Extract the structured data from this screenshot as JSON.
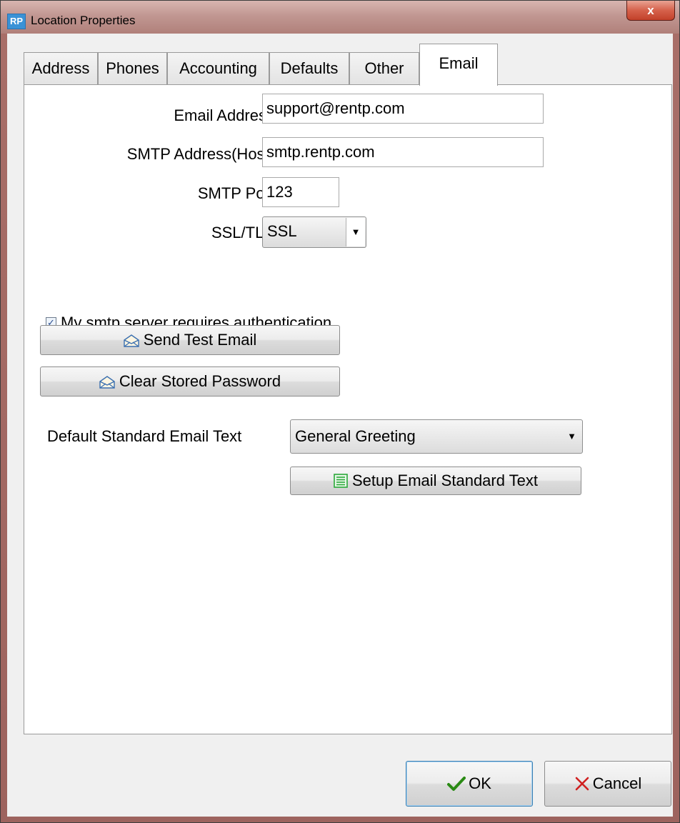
{
  "window": {
    "title": "Location Properties",
    "app_icon": "RP",
    "close_glyph": "x"
  },
  "tabs": [
    {
      "label": "Address",
      "active": false
    },
    {
      "label": "Phones",
      "active": false
    },
    {
      "label": "Accounting",
      "active": false
    },
    {
      "label": "Defaults",
      "active": false
    },
    {
      "label": "Other",
      "active": false
    },
    {
      "label": "Email",
      "active": true
    }
  ],
  "email_tab": {
    "email_address_label": "Email Address",
    "email_address_value": "support@rentp.com",
    "smtp_host_label": "SMTP Address(Host)",
    "smtp_host_value": "smtp.rentp.com",
    "smtp_port_label": "SMTP Port",
    "smtp_port_value": "123",
    "ssl_label": "SSL/TLS",
    "ssl_value": "SSL",
    "auth_checkbox_label": "My smtp server requires authentication",
    "auth_checked": true,
    "send_test_label": "Send Test Email",
    "clear_password_label": "Clear Stored Password",
    "default_text_label": "Default Standard Email Text",
    "default_text_value": "General Greeting",
    "setup_text_label": "Setup Email Standard Text"
  },
  "footer": {
    "ok_label": "OK",
    "cancel_label": "Cancel"
  },
  "icons": {
    "ok": "checkmark-icon",
    "cancel": "x-icon",
    "email": "envelope-icon",
    "setup": "list-icon"
  },
  "colors": {
    "ok_check": "#2a8a14",
    "cancel_x": "#d02020",
    "titlebar": "#c19792",
    "list_icon": "#2aa83a"
  }
}
